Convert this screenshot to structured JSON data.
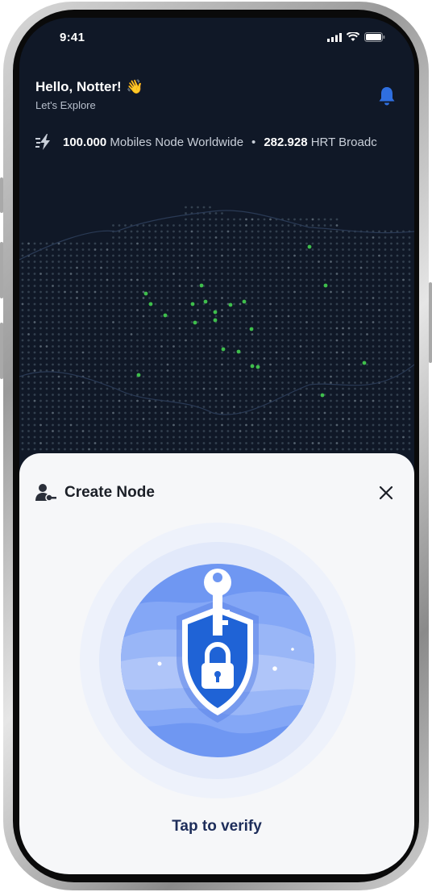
{
  "status_bar": {
    "time": "9:41"
  },
  "header": {
    "greeting": "Hello, Notter!",
    "greeting_emoji": "👋",
    "subtitle": "Let's Explore",
    "bell_icon": "bell-icon"
  },
  "ticker": {
    "icon": "lightning-speed-icon",
    "stat1_value": "100.000",
    "stat1_label": "Mobiles Node Worldwide",
    "separator": "•",
    "stat2_value": "282.928",
    "stat2_label": "HRT Broadc"
  },
  "sheet": {
    "icon": "user-key-icon",
    "title": "Create Node",
    "close_icon": "close-icon",
    "illustration": "shield-key-lock-icon",
    "action_label": "Tap to verify"
  },
  "colors": {
    "map_background": "#101827",
    "node_green": "#3fbf4c",
    "accent_blue": "#2f6fe0",
    "sheet_background": "#f6f7f9",
    "action_text": "#1d2d5a"
  }
}
